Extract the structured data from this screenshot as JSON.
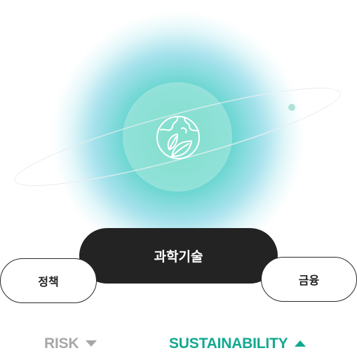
{
  "illustration": {
    "icon": "globe-leaf-icon"
  },
  "categories": {
    "center_label": "과학기술",
    "left_label": "정책",
    "right_label": "금융"
  },
  "tabs": [
    {
      "label": "RISK",
      "state": "collapsed",
      "color": "#a7a7a7"
    },
    {
      "label": "SUSTAINABILITY",
      "state": "expanded",
      "color": "#11a98f"
    }
  ],
  "colors": {
    "accent": "#11a98f",
    "dark_pill": "#232323",
    "muted": "#a7a7a7"
  }
}
